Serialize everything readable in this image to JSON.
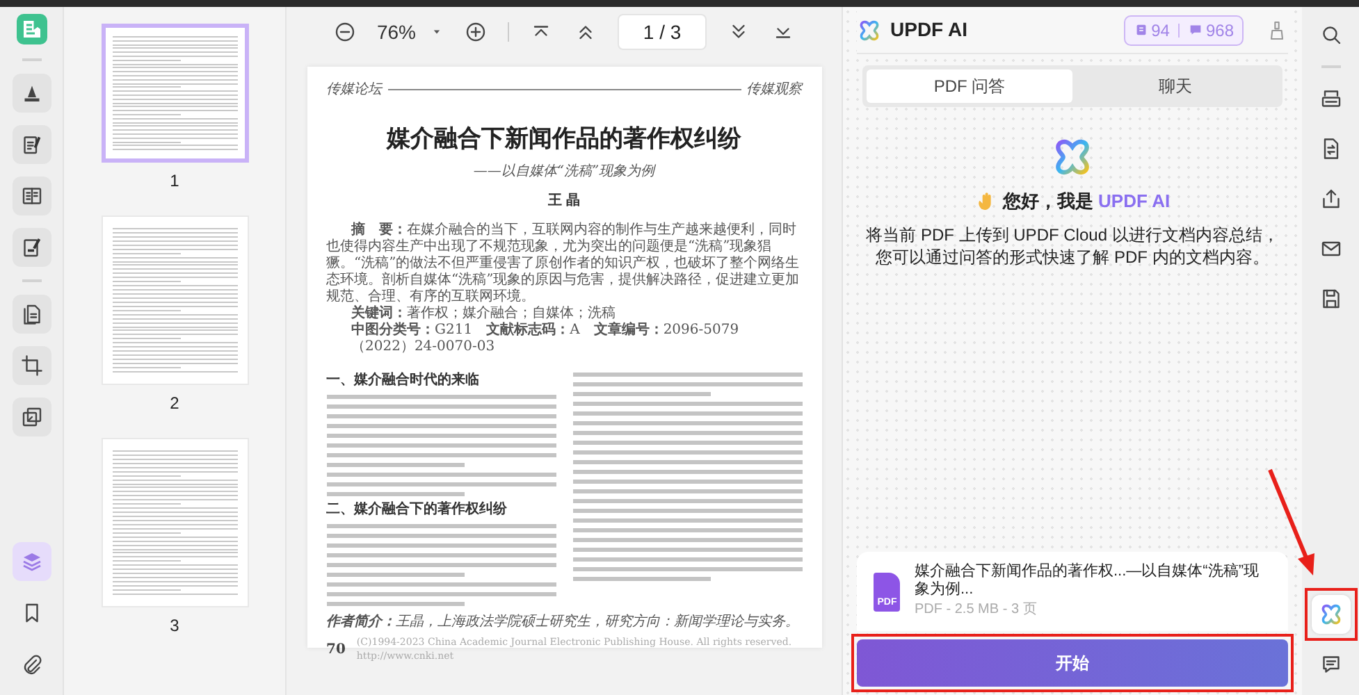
{
  "left_rail": {
    "groups": [
      [
        {
          "kind": "comment",
          "selected": false
        },
        {
          "kind": "edit",
          "selected": false
        },
        {
          "kind": "reader",
          "selected": false
        },
        {
          "kind": "sign",
          "selected": false
        }
      ],
      [
        {
          "kind": "organize",
          "selected": false
        },
        {
          "kind": "crop",
          "selected": false
        },
        {
          "kind": "page-tools",
          "selected": false
        }
      ]
    ],
    "bottom": [
      {
        "kind": "layers",
        "selected": true
      },
      {
        "kind": "bookmark",
        "selected": false
      },
      {
        "kind": "attachment",
        "selected": false
      }
    ]
  },
  "thumbnails": [
    {
      "label": "1",
      "selected": true
    },
    {
      "label": "2",
      "selected": false
    },
    {
      "label": "3",
      "selected": false
    }
  ],
  "toolbar": {
    "zoom": "76%",
    "page_field": "1 / 3"
  },
  "document": {
    "header_left": "传媒论坛",
    "header_right": "传媒观察",
    "title": "媒介融合下新闻作品的著作权纠纷",
    "subtitle": "——以自媒体“洗稿”现象为例",
    "author": "王 晶",
    "abstract": "**摘　要：**在媒介融合的当下，互联网内容的制作与生产越来越便利，同时也使得内容生产中出现了不规范现象，尤为突出的问题便是“洗稿”现象猖獗。“洗稿”的做法不但严重侵害了原创作者的知识产权，也破坏了整个网络生态环境。剖析自媒体“洗稿”现象的原因与危害，提供解决路径，促进建立更加规范、合理、有序的互联网环境。",
    "keywords": "**关键词：**著作权；媒介融合；自媒体；洗稿",
    "classification": "**中图分类号：**G211　**文献标志码：**A　**文章编号：**2096-5079（2022）24-0070-03",
    "sections": [
      {
        "heading": "一、媒介融合时代的来临"
      },
      {
        "heading": "二、媒介融合下的著作权纠纷"
      }
    ],
    "footnote": "**作者简介：**王晶，上海政法学院硕士研究生，研究方向：新闻学理论与实务。",
    "page_number": "70",
    "copyright": "(C)1994-2023 China Academic Journal Electronic Publishing House. All rights reserved.　http://www.cnki.net"
  },
  "ai_panel": {
    "title": "UPDF AI",
    "quota": [
      "94",
      "968"
    ],
    "tabs": [
      {
        "label": "PDF 问答",
        "selected": true
      },
      {
        "label": "聊天",
        "selected": false
      }
    ],
    "greeting": {
      "lead": "您好，我是 ",
      "brand": "UPDF AI"
    },
    "description": "将当前 PDF 上传到 UPDF Cloud 以进行文档内容总结，您可以通过问答的形式快速了解 PDF 内的文档内容。",
    "file": {
      "icon_label": "PDF",
      "name": "媒介融合下新闻作品的著作权...—以自媒体“洗稿”现象为例...",
      "meta": "PDF - 2.5 MB - 3 页"
    },
    "start_button": "开始"
  },
  "right_rail": {
    "top": [
      {
        "kind": "search",
        "selected": false
      },
      {
        "kind": "ocr",
        "selected": false
      },
      {
        "kind": "convert",
        "selected": false
      },
      {
        "kind": "share",
        "selected": false
      },
      {
        "kind": "mail",
        "selected": false
      },
      {
        "kind": "save",
        "selected": false
      }
    ],
    "bottom": [
      {
        "kind": "ai",
        "selected": true
      },
      {
        "kind": "comment",
        "selected": false
      }
    ]
  }
}
